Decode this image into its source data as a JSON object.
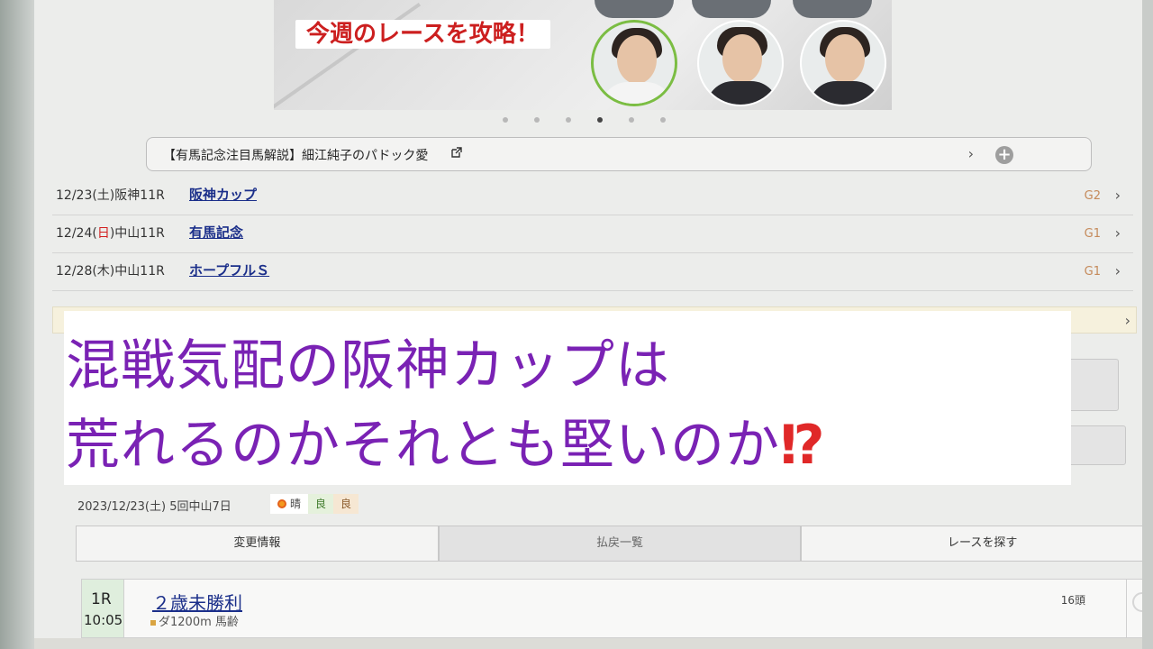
{
  "banner": {
    "heading": "今週のレースを攻略！",
    "slide_count": 6,
    "active_slide": 4
  },
  "newsbar": {
    "text": "【有馬記念注目馬解説】細江純子のパドック愛"
  },
  "races": [
    {
      "date_prefix": "12/23(土)",
      "venue": "阪神11R",
      "name": "阪神カップ",
      "grade": "G2"
    },
    {
      "date_prefix": "12/24(",
      "sunday": "日",
      "date_suffix": ")",
      "venue": "中山11R",
      "name": "有馬記念",
      "grade": "G1"
    },
    {
      "date_prefix": "12/28(木)",
      "venue": "中山11R",
      "name": "ホープフルＳ",
      "grade": "G1"
    }
  ],
  "caption": {
    "line1": "混戦気配の阪神カップは",
    "line2": "荒れるのかそれとも堅いのか",
    "mark": "⁉"
  },
  "meeting": {
    "date": "2023/12/23(土) 5回中山7日",
    "weather": "晴",
    "turf": "良",
    "dirt": "良"
  },
  "tabs": [
    "変更情報",
    "払戻一覧",
    "レースを探す"
  ],
  "program": {
    "race_no": "1R",
    "time": "10:05",
    "title": "２歳未勝利",
    "sub": "ダ1200m 馬齢",
    "heads": "16頭"
  },
  "colors": {
    "caption_text": "#7a22b4",
    "link": "#1b2f8a",
    "grade": "#c58a5a",
    "banner_heading": "#cc1f1f"
  }
}
